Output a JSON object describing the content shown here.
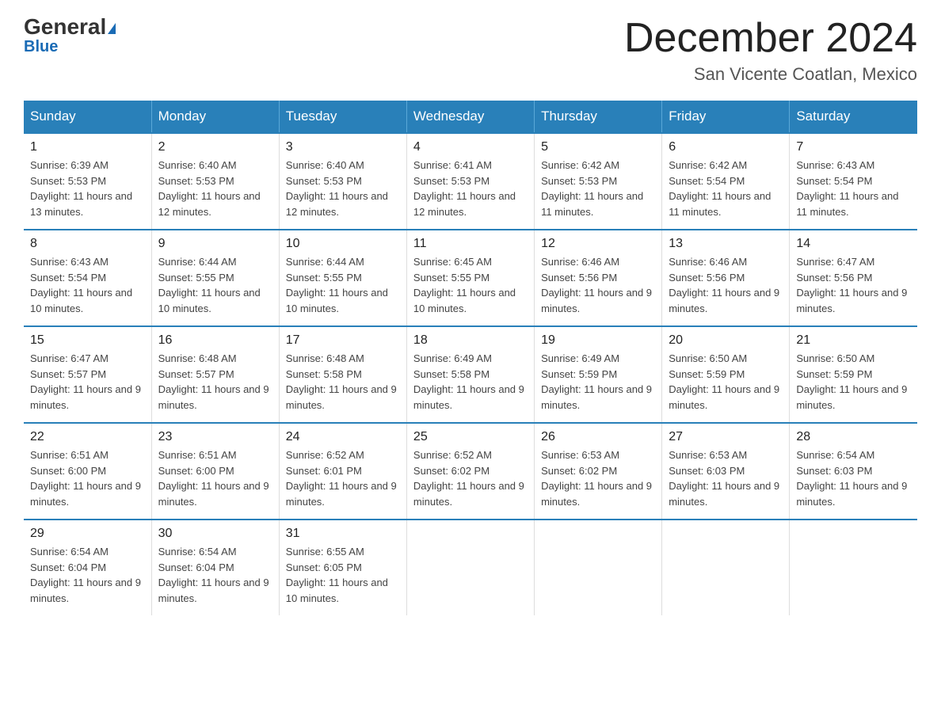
{
  "header": {
    "logo_main": "General",
    "logo_sub": "Blue",
    "month_title": "December 2024",
    "location": "San Vicente Coatlan, Mexico"
  },
  "weekdays": [
    "Sunday",
    "Monday",
    "Tuesday",
    "Wednesday",
    "Thursday",
    "Friday",
    "Saturday"
  ],
  "weeks": [
    [
      {
        "day": "1",
        "sunrise": "6:39 AM",
        "sunset": "5:53 PM",
        "daylight": "11 hours and 13 minutes."
      },
      {
        "day": "2",
        "sunrise": "6:40 AM",
        "sunset": "5:53 PM",
        "daylight": "11 hours and 12 minutes."
      },
      {
        "day": "3",
        "sunrise": "6:40 AM",
        "sunset": "5:53 PM",
        "daylight": "11 hours and 12 minutes."
      },
      {
        "day": "4",
        "sunrise": "6:41 AM",
        "sunset": "5:53 PM",
        "daylight": "11 hours and 12 minutes."
      },
      {
        "day": "5",
        "sunrise": "6:42 AM",
        "sunset": "5:53 PM",
        "daylight": "11 hours and 11 minutes."
      },
      {
        "day": "6",
        "sunrise": "6:42 AM",
        "sunset": "5:54 PM",
        "daylight": "11 hours and 11 minutes."
      },
      {
        "day": "7",
        "sunrise": "6:43 AM",
        "sunset": "5:54 PM",
        "daylight": "11 hours and 11 minutes."
      }
    ],
    [
      {
        "day": "8",
        "sunrise": "6:43 AM",
        "sunset": "5:54 PM",
        "daylight": "11 hours and 10 minutes."
      },
      {
        "day": "9",
        "sunrise": "6:44 AM",
        "sunset": "5:55 PM",
        "daylight": "11 hours and 10 minutes."
      },
      {
        "day": "10",
        "sunrise": "6:44 AM",
        "sunset": "5:55 PM",
        "daylight": "11 hours and 10 minutes."
      },
      {
        "day": "11",
        "sunrise": "6:45 AM",
        "sunset": "5:55 PM",
        "daylight": "11 hours and 10 minutes."
      },
      {
        "day": "12",
        "sunrise": "6:46 AM",
        "sunset": "5:56 PM",
        "daylight": "11 hours and 9 minutes."
      },
      {
        "day": "13",
        "sunrise": "6:46 AM",
        "sunset": "5:56 PM",
        "daylight": "11 hours and 9 minutes."
      },
      {
        "day": "14",
        "sunrise": "6:47 AM",
        "sunset": "5:56 PM",
        "daylight": "11 hours and 9 minutes."
      }
    ],
    [
      {
        "day": "15",
        "sunrise": "6:47 AM",
        "sunset": "5:57 PM",
        "daylight": "11 hours and 9 minutes."
      },
      {
        "day": "16",
        "sunrise": "6:48 AM",
        "sunset": "5:57 PM",
        "daylight": "11 hours and 9 minutes."
      },
      {
        "day": "17",
        "sunrise": "6:48 AM",
        "sunset": "5:58 PM",
        "daylight": "11 hours and 9 minutes."
      },
      {
        "day": "18",
        "sunrise": "6:49 AM",
        "sunset": "5:58 PM",
        "daylight": "11 hours and 9 minutes."
      },
      {
        "day": "19",
        "sunrise": "6:49 AM",
        "sunset": "5:59 PM",
        "daylight": "11 hours and 9 minutes."
      },
      {
        "day": "20",
        "sunrise": "6:50 AM",
        "sunset": "5:59 PM",
        "daylight": "11 hours and 9 minutes."
      },
      {
        "day": "21",
        "sunrise": "6:50 AM",
        "sunset": "5:59 PM",
        "daylight": "11 hours and 9 minutes."
      }
    ],
    [
      {
        "day": "22",
        "sunrise": "6:51 AM",
        "sunset": "6:00 PM",
        "daylight": "11 hours and 9 minutes."
      },
      {
        "day": "23",
        "sunrise": "6:51 AM",
        "sunset": "6:00 PM",
        "daylight": "11 hours and 9 minutes."
      },
      {
        "day": "24",
        "sunrise": "6:52 AM",
        "sunset": "6:01 PM",
        "daylight": "11 hours and 9 minutes."
      },
      {
        "day": "25",
        "sunrise": "6:52 AM",
        "sunset": "6:02 PM",
        "daylight": "11 hours and 9 minutes."
      },
      {
        "day": "26",
        "sunrise": "6:53 AM",
        "sunset": "6:02 PM",
        "daylight": "11 hours and 9 minutes."
      },
      {
        "day": "27",
        "sunrise": "6:53 AM",
        "sunset": "6:03 PM",
        "daylight": "11 hours and 9 minutes."
      },
      {
        "day": "28",
        "sunrise": "6:54 AM",
        "sunset": "6:03 PM",
        "daylight": "11 hours and 9 minutes."
      }
    ],
    [
      {
        "day": "29",
        "sunrise": "6:54 AM",
        "sunset": "6:04 PM",
        "daylight": "11 hours and 9 minutes."
      },
      {
        "day": "30",
        "sunrise": "6:54 AM",
        "sunset": "6:04 PM",
        "daylight": "11 hours and 9 minutes."
      },
      {
        "day": "31",
        "sunrise": "6:55 AM",
        "sunset": "6:05 PM",
        "daylight": "11 hours and 10 minutes."
      },
      null,
      null,
      null,
      null
    ]
  ]
}
